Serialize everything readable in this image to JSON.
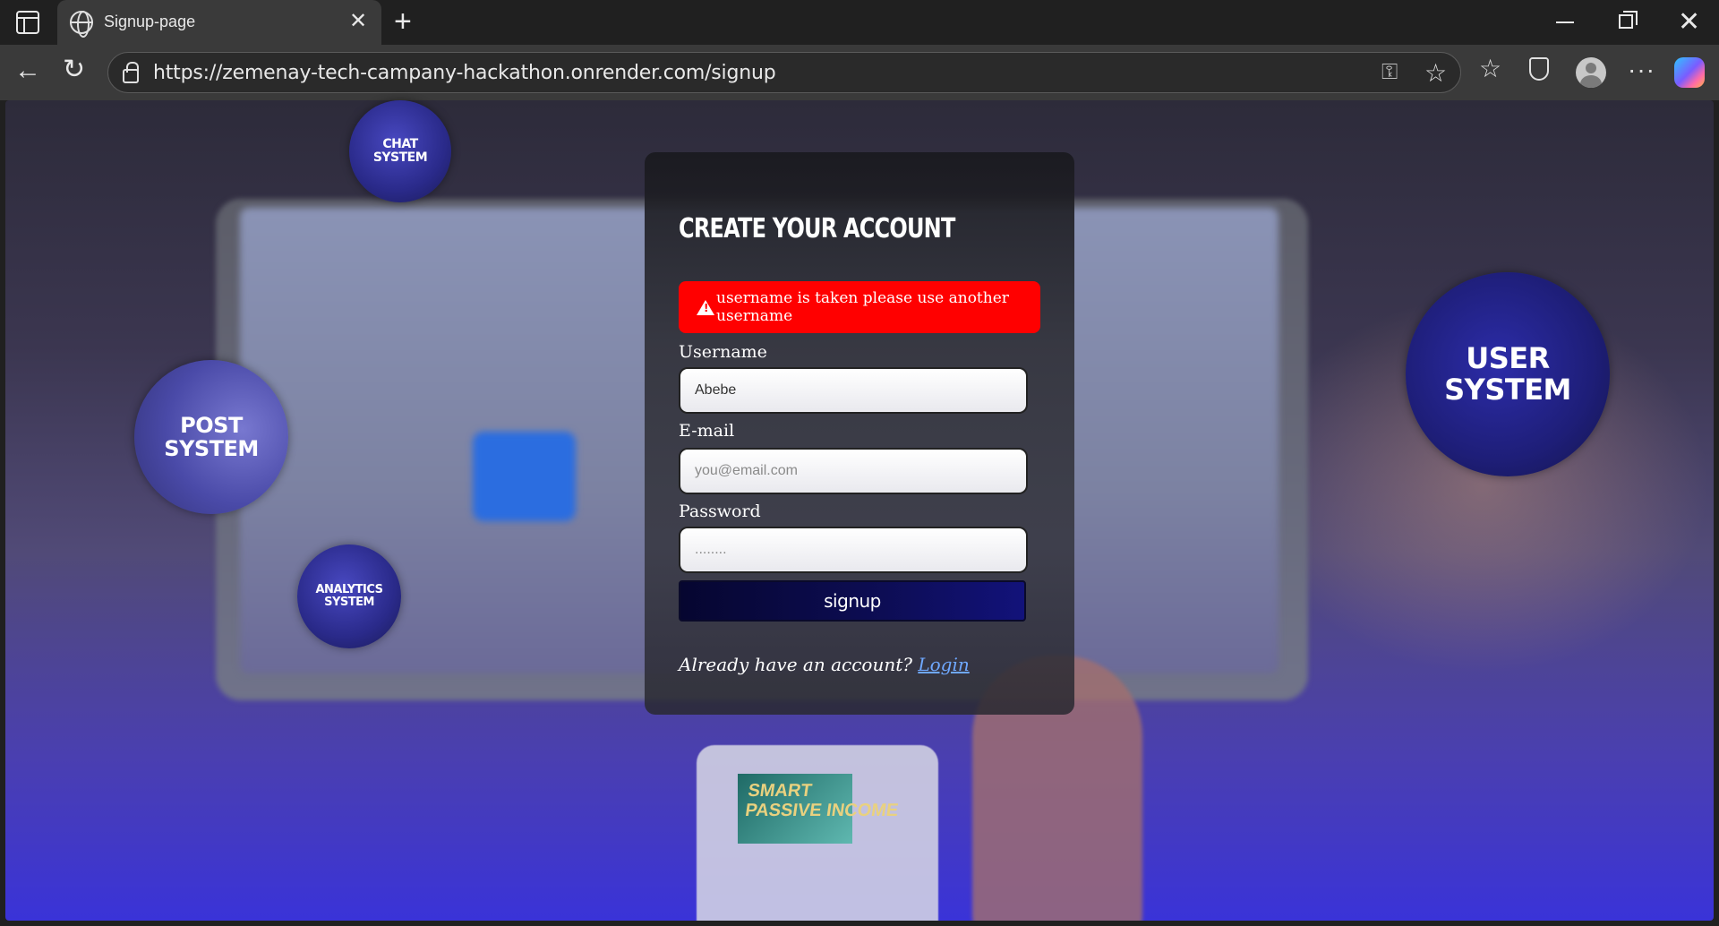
{
  "browser": {
    "tab_title": "Signup-page",
    "url": "https://zemenay-tech-campany-hackathon.onrender.com/signup",
    "new_tab_label": "+",
    "close_tab_label": "✕",
    "window_close_label": "✕"
  },
  "bubbles": {
    "chat": [
      "CHAT",
      "SYSTEM"
    ],
    "post": [
      "POST",
      "SYSTEM"
    ],
    "analytics": [
      "ANALYTICS",
      "SYSTEM"
    ],
    "user": [
      "USER",
      "SYSTEM"
    ]
  },
  "form": {
    "title": "CREATE YOUR ACCOUNT",
    "error_message": "username is taken please use another username",
    "username_label": "Username",
    "username_value": "Abebe",
    "email_label": "E-mail",
    "email_placeholder": "you@email.com",
    "password_label": "Password",
    "password_value": "........",
    "submit_label": "signup",
    "footer_text": "Already have an account? ",
    "login_link": "Login"
  },
  "background_art": {
    "phone_text_line1": "SMART",
    "phone_text_line2": "PASSIVE INCOME"
  },
  "colors": {
    "error_bg": "#ff0000",
    "button_bg": "#0d0d55",
    "link": "#6fa8ff"
  }
}
